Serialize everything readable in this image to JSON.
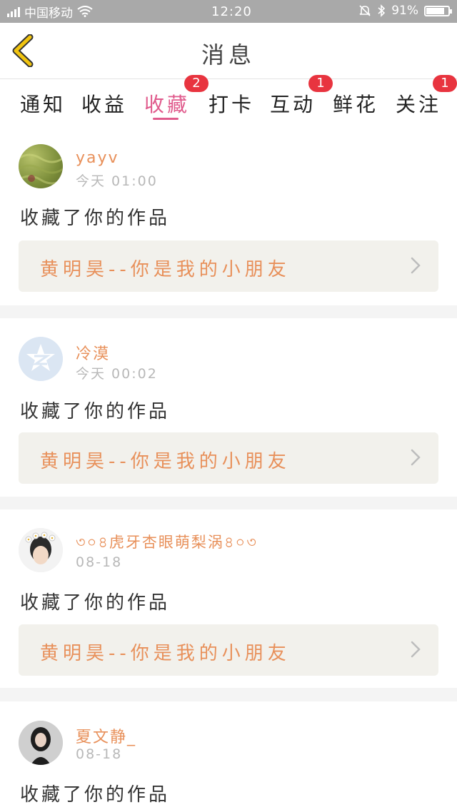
{
  "status_bar": {
    "carrier": "中国移动",
    "time": "12:20",
    "battery": "91%",
    "battery_level": 0.91
  },
  "header": {
    "title": "消息"
  },
  "tabs": [
    {
      "label": "通知",
      "badge": null
    },
    {
      "label": "收益",
      "badge": null
    },
    {
      "label": "收藏",
      "badge": "2",
      "active": true
    },
    {
      "label": "打卡",
      "badge": null
    },
    {
      "label": "互动",
      "badge": "1"
    },
    {
      "label": "鲜花",
      "badge": null
    },
    {
      "label": "关注",
      "badge": "1"
    }
  ],
  "messages": [
    {
      "user": "yayv",
      "time": "今天 01:00",
      "action": "收藏了你的作品",
      "work": "黄明昊--你是我的小朋友"
    },
    {
      "user": "冷漠",
      "time": "今天 00:02",
      "action": "收藏了你的作品",
      "work": "黄明昊--你是我的小朋友"
    },
    {
      "user": "৩০৪虎牙杏眼萌梨涡৪০৩",
      "time": "08-18",
      "action": "收藏了你的作品",
      "work": "黄明昊--你是我的小朋友"
    },
    {
      "user": "夏文静_",
      "time": "08-18",
      "action": "收藏了你的作品",
      "work": ""
    }
  ],
  "colors": {
    "accent_pink": "#e05a8c",
    "username_orange": "#e8905a",
    "badge_red": "#e8343f",
    "back_arrow_yellow": "#f1c40f"
  }
}
